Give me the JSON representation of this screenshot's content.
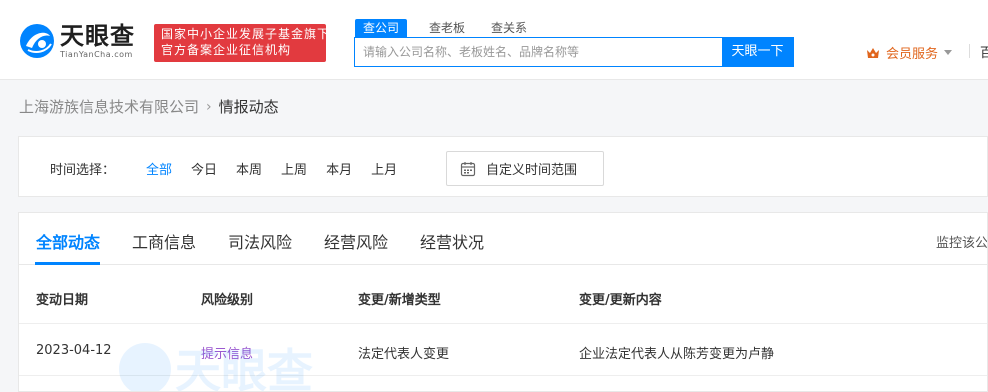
{
  "header": {
    "logo_cn": "天眼查",
    "logo_en": "TianYanCha.com",
    "slogan_line1": "国家中小企业发展子基金旗下",
    "slogan_line2": "官方备案企业征信机构",
    "search_tabs": [
      "查公司",
      "查老板",
      "查关系"
    ],
    "search_placeholder": "请输入公司名称、老板姓名、品牌名称等",
    "search_button": "天眼一下",
    "vip_label": "会员服务",
    "more_label": "百",
    "colors": {
      "accent": "#0084ff",
      "slogan_bg": "#e23a3f",
      "vip": "#e0651c"
    }
  },
  "breadcrumb": {
    "company": "上海游族信息技术有限公司",
    "separator": "›",
    "current": "情报动态"
  },
  "filter": {
    "label": "时间选择：",
    "options": [
      "全部",
      "今日",
      "本周",
      "上周",
      "本月",
      "上月"
    ],
    "active": "全部",
    "custom_range": "自定义时间范围"
  },
  "tabs": {
    "items": [
      "全部动态",
      "工商信息",
      "司法风险",
      "经营风险",
      "经营状况"
    ],
    "active": "全部动态",
    "monitor": "监控该公"
  },
  "table": {
    "columns": [
      "变动日期",
      "风险级别",
      "变更/新增类型",
      "变更/更新内容"
    ],
    "rows": [
      {
        "date": "2023-04-12",
        "risk": "提示信息",
        "type": "法定代表人变更",
        "content": "企业法定代表人从陈芳变更为卢静"
      }
    ]
  },
  "watermark": "天眼查"
}
